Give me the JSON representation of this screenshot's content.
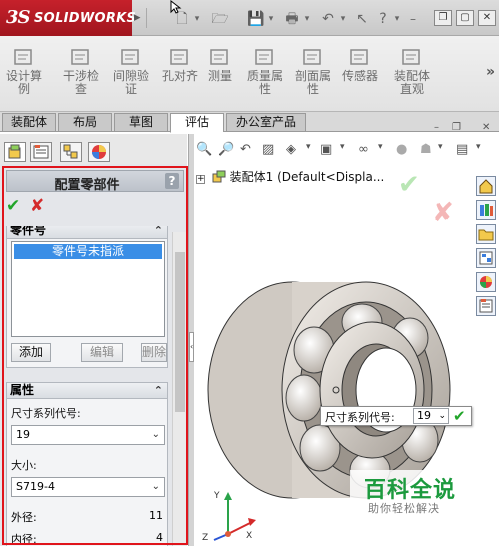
{
  "titlebar": {
    "logo_text": "SOLIDWORKS",
    "logo_mark": "3S"
  },
  "command_manager": {
    "items": [
      {
        "label": "设计算\n例",
        "icon": "design-study-icon"
      },
      {
        "label": "干涉检\n查",
        "icon": "interference-check-icon"
      },
      {
        "label": "间隙验\n证",
        "icon": "clearance-verification-icon"
      },
      {
        "label": "孔对齐",
        "icon": "hole-alignment-icon"
      },
      {
        "label": "测量",
        "icon": "measure-icon"
      },
      {
        "label": "质量属\n性",
        "icon": "mass-properties-icon"
      },
      {
        "label": "剖面属\n性",
        "icon": "section-properties-icon"
      },
      {
        "label": "传感器",
        "icon": "sensor-icon"
      },
      {
        "label": "装配体\n直观",
        "icon": "assembly-visualization-icon"
      }
    ],
    "more": "»"
  },
  "tabs": [
    {
      "label": "装配体",
      "active": false
    },
    {
      "label": "布局",
      "active": false
    },
    {
      "label": "草图",
      "active": false
    },
    {
      "label": "评估",
      "active": true
    },
    {
      "label": "办公室产品",
      "active": false
    }
  ],
  "property_manager": {
    "title": "配置零部件",
    "help": "?",
    "part_number_group": {
      "title": "零件号",
      "list_items": [
        "零件号未指派"
      ],
      "buttons": [
        {
          "label": "添加",
          "enabled": true
        },
        {
          "label": "编辑",
          "enabled": false
        },
        {
          "label": "删除",
          "enabled": false
        }
      ]
    },
    "properties_group": {
      "title": "属性",
      "size_series_label": "尺寸系列代号:",
      "size_series_value": "19",
      "size_label": "大小:",
      "size_value": "S719-4",
      "outer_diameter_label": "外径:",
      "outer_diameter_value": "11",
      "inner_diameter_label": "内径:",
      "inner_diameter_value": "4"
    }
  },
  "graphics": {
    "tree_node": "装配体1  (Default<Displa...",
    "dimension_popup": {
      "label": "尺寸系列代号:",
      "value": "19"
    }
  },
  "watermark": {
    "title": "百科全说",
    "subtitle": "助你轻松解决"
  },
  "colors": {
    "accent_red": "#e0141b",
    "ok_green": "#22a52a",
    "selection_blue": "#3a8ee6",
    "brand_red": "#c6212b"
  }
}
